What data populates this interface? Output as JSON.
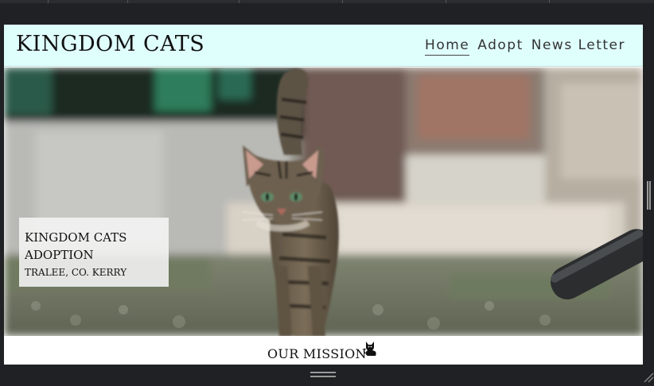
{
  "brand": {
    "name": "KINGDOM CATS"
  },
  "nav": {
    "items": [
      {
        "label": "Home",
        "active": true
      },
      {
        "label": "Adopt",
        "active": false
      },
      {
        "label": "News Letter",
        "active": false
      }
    ]
  },
  "hero": {
    "caption_line1": "KINGDOM CATS",
    "caption_line2": "ADOPTION",
    "caption_line3": "TRALEE, CO. KERRY"
  },
  "mission": {
    "title": "OUR MISSION",
    "icon": "black-cat-icon"
  },
  "colors": {
    "navbar_bg": "#dffffd",
    "page_bg": "#202124"
  }
}
